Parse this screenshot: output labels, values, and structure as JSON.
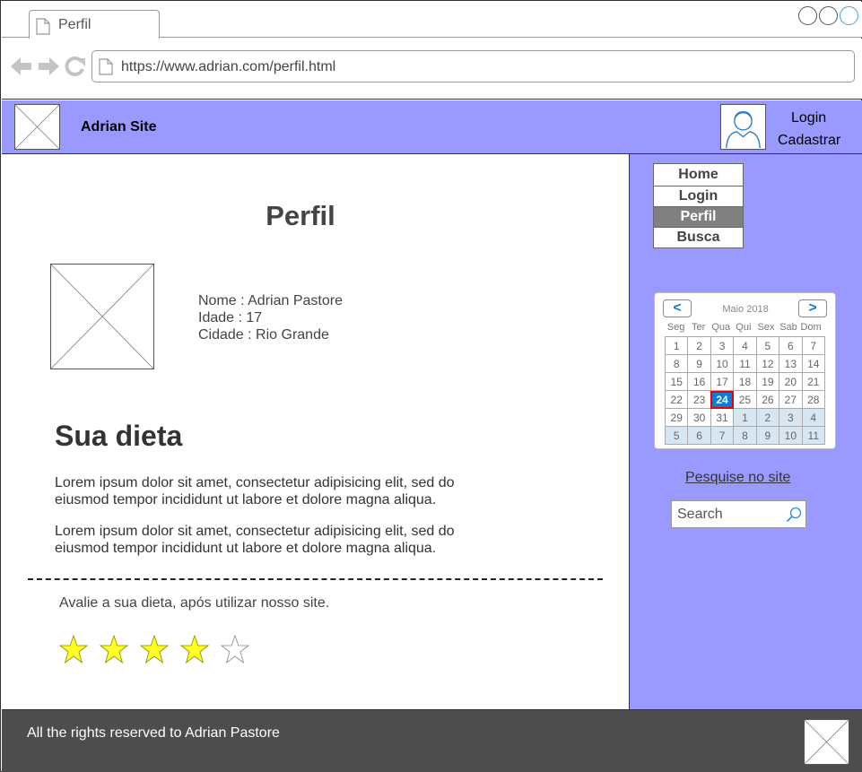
{
  "browser": {
    "tab_title": "Perfil",
    "url": "https://www.adrian.com/perfil.html"
  },
  "header": {
    "site_name": "Adrian Site",
    "login": "Login",
    "signup": "Cadastrar"
  },
  "sidebar": {
    "menu": [
      {
        "label": "Home",
        "active": false
      },
      {
        "label": "Login",
        "active": false
      },
      {
        "label": "Perfil",
        "active": true
      },
      {
        "label": "Busca",
        "active": false
      }
    ],
    "calendar": {
      "title": "Maio 2018",
      "prev": "<",
      "next": ">",
      "weekdays": [
        "Seg",
        "Ter",
        "Qua",
        "Qui",
        "Sex",
        "Sab",
        "Dom"
      ],
      "weeks": [
        [
          "1",
          "2",
          "3",
          "4",
          "5",
          "6",
          "7"
        ],
        [
          "8",
          "9",
          "10",
          "11",
          "12",
          "13",
          "14"
        ],
        [
          "15",
          "16",
          "17",
          "18",
          "19",
          "20",
          "21"
        ],
        [
          "22",
          "23",
          "24",
          "25",
          "26",
          "27",
          "28"
        ],
        [
          "29",
          "30",
          "31",
          "1",
          "2",
          "3",
          "4"
        ],
        [
          "5",
          "6",
          "7",
          "8",
          "9",
          "10",
          "11"
        ]
      ],
      "selected_day": "24"
    },
    "search_link": "Pesquise no site",
    "search_placeholder": "Search"
  },
  "main": {
    "title": "Perfil",
    "profile": {
      "name": "Nome : Adrian Pastore",
      "age": "Idade : 17",
      "city": "Cidade : Rio Grande"
    },
    "diet_heading": "Sua dieta",
    "paragraphs": [
      "Lorem ipsum dolor sit amet, consectetur adipisicing elit, sed do eiusmod tempor incididunt ut labore et dolore magna aliqua.",
      "Lorem ipsum dolor sit amet, consectetur adipisicing elit, sed do eiusmod tempor incididunt ut labore et dolore magna aliqua."
    ],
    "rating_label": "Avalie a sua dieta, após utilizar nosso site.",
    "rating": {
      "value": 4,
      "max": 5
    }
  },
  "footer": {
    "text": "All the rights reserved to Adrian Pastore"
  },
  "colors": {
    "header_bg": "#9999ff",
    "footer_bg": "#4d4d4d",
    "star_fill": "#ffff22",
    "calendar_accent": "#0a7dd8"
  }
}
